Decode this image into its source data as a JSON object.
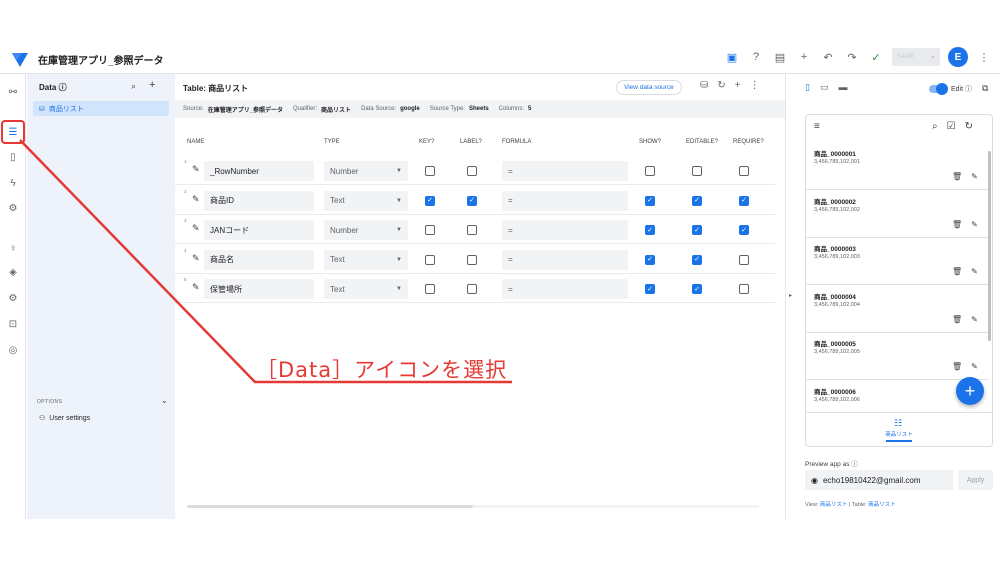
{
  "app": {
    "title": "在庫管理アプリ_参照データ"
  },
  "topbar": {
    "save_label": "SAVE",
    "avatar_letter": "E"
  },
  "data_panel": {
    "header": "Data ⓘ",
    "items": [
      {
        "label": "商品リスト"
      }
    ],
    "options_label": "OPTIONS",
    "user_settings": "User settings"
  },
  "main": {
    "table_title": "Table: 商品リスト",
    "view_source": "View data source",
    "subhead": {
      "source_label": "Source:",
      "source": "在庫管理アプリ_参照データ",
      "qualifier_label": "Qualifier:",
      "qualifier": "商品リスト",
      "datasource_label": "Data Source:",
      "datasource": "google",
      "sourcetype_label": "Source Type:",
      "sourcetype": "Sheets",
      "columns_label": "Columns:",
      "columns": "5"
    },
    "columns": [
      "NAME",
      "TYPE",
      "KEY?",
      "LABEL?",
      "FORMULA",
      "SHOW?",
      "EDITABLE?",
      "REQUIRE?"
    ],
    "rows": [
      {
        "num": "1",
        "name": "_RowNumber",
        "type": "Number",
        "formula": "=",
        "key": false,
        "label": false,
        "show": false,
        "editable": false,
        "require": false
      },
      {
        "num": "2",
        "name": "商品ID",
        "type": "Text",
        "formula": "=",
        "key": true,
        "label": true,
        "show": true,
        "editable": true,
        "require": true
      },
      {
        "num": "3",
        "name": "JANコード",
        "type": "Number",
        "formula": "=",
        "key": false,
        "label": false,
        "show": true,
        "editable": true,
        "require": true
      },
      {
        "num": "4",
        "name": "商品名",
        "type": "Text",
        "formula": "=",
        "key": false,
        "label": false,
        "show": true,
        "editable": true,
        "require": false
      },
      {
        "num": "5",
        "name": "保管場所",
        "type": "Text",
        "formula": "=",
        "key": false,
        "label": false,
        "show": true,
        "editable": true,
        "require": false
      }
    ]
  },
  "preview": {
    "edit_label": "Edit ⓘ",
    "cards": [
      {
        "title": "商品_0000001",
        "sub": "3,456,789,102,001"
      },
      {
        "title": "商品_0000002",
        "sub": "3,456,789,102,002"
      },
      {
        "title": "商品_0000003",
        "sub": "3,456,789,102,003"
      },
      {
        "title": "商品_0000004",
        "sub": "3,456,789,102,004"
      },
      {
        "title": "商品_0000005",
        "sub": "3,456,789,102,005"
      },
      {
        "title": "商品_0000006",
        "sub": "3,456,789,102,006"
      }
    ],
    "nav_label": "商品リスト",
    "preview_as": "Preview app as ⓘ",
    "email": "echo19810422@gmail.com",
    "apply": "Apply",
    "view_prefix": "View:",
    "view_name": "商品リスト",
    "separator": "|",
    "table_prefix": "Table:",
    "table_name": "商品リスト"
  },
  "annotation": {
    "text": "［Data］アイコンを選択",
    "color": "#e53935"
  },
  "colors": {
    "accent": "#1a73e8",
    "annotation": "#e53935",
    "panel_bg": "#eef3fb"
  }
}
